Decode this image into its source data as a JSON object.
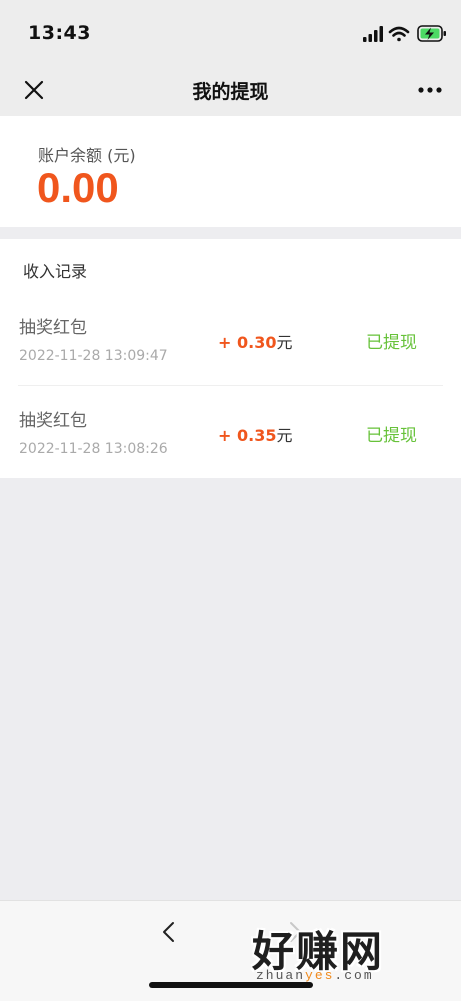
{
  "status_bar": {
    "time": "13:43",
    "icons": [
      "cellular-signal-icon",
      "wifi-icon",
      "battery-charging-icon"
    ]
  },
  "nav": {
    "title": "我的提现",
    "close_icon": "close-icon",
    "more_icon": "more-icon"
  },
  "balance": {
    "label": "账户余额 (元)",
    "value": "0.00"
  },
  "records": {
    "header": "收入记录",
    "items": [
      {
        "title": "抽奖红包",
        "time": "2022-11-28 13:09:47",
        "amount": "+ 0.30",
        "unit": "元",
        "status": "已提现"
      },
      {
        "title": "抽奖红包",
        "time": "2022-11-28 13:08:26",
        "amount": "+ 0.35",
        "unit": "元",
        "status": "已提现"
      }
    ]
  },
  "bottom_bar": {
    "back_icon": "chevron-left-icon",
    "forward_icon": "chevron-right-icon"
  },
  "watermark": {
    "logo": "好赚网",
    "url_prefix": "zhuan",
    "url_accent": "yes",
    "url_suffix": ".com"
  },
  "colors": {
    "accent": "#f0561d",
    "status_green": "#67c23a",
    "background": "#ededf0"
  }
}
